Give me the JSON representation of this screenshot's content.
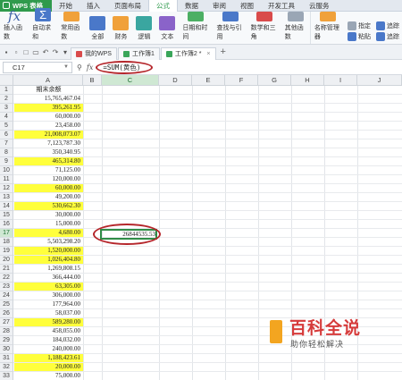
{
  "app": {
    "name": "WPS 表格"
  },
  "menu": [
    "开始",
    "插入",
    "页面布局",
    "公式",
    "数据",
    "审阅",
    "视图",
    "开发工具",
    "云服务"
  ],
  "menu_active_index": 3,
  "ribbon": {
    "insert_function": "插入函数",
    "autosum": "自动求和",
    "common_functions": "常用函数",
    "all": "全部",
    "finance": "财务",
    "logic": "逻辑",
    "text": "文本",
    "datetime": "日期和时间",
    "lookup": "查找与引用",
    "math": "数学和三角",
    "other": "其他函数",
    "name_manager": "名称管理器",
    "paste": "粘贴",
    "specify": "指定",
    "trace_precedents": "追踪",
    "trace_dependents": "追踪"
  },
  "doc_tabs": [
    {
      "label": "我的WPS"
    },
    {
      "label": "工作簿1"
    },
    {
      "label": "工作簿2 *"
    }
  ],
  "formula_bar": {
    "name_box": "C17",
    "formula": "=SUM(黄色)"
  },
  "sheet": {
    "columns": [
      "A",
      "B",
      "C",
      "D",
      "E",
      "F",
      "G",
      "H",
      "I",
      "J"
    ],
    "selected_column": "C",
    "selected_row": 17,
    "header_cell": "期末余额",
    "values": [
      "15,765,467.04",
      "395,261.95",
      "60,000.00",
      "23,458.00",
      "21,008,073.07",
      "7,123,787.30",
      "350,340.95",
      "465,314.80",
      "71,125.00",
      "120,000.00",
      "60,000.00",
      "49,200.00",
      "530,662.30",
      "30,000.00",
      "15,000.00",
      "4,680.00",
      "5,503,298.20",
      "1,520,000.00",
      "1,026,404.80",
      "1,269,808.15",
      "366,444.00",
      "63,305.00",
      "306,000.00",
      "177,964.00",
      "58,037.00",
      "589,280.00",
      "458,055.00",
      "184,032.00",
      "240,000.00",
      "1,188,423.61",
      "20,000.00",
      "75,000.00"
    ],
    "highlighted_rows": [
      3,
      6,
      9,
      12,
      14,
      17,
      19,
      20,
      23,
      27,
      31,
      32
    ],
    "result_value": "26844535.53"
  },
  "watermark": {
    "title": "百科全说",
    "subtitle": "助你轻松解决"
  }
}
